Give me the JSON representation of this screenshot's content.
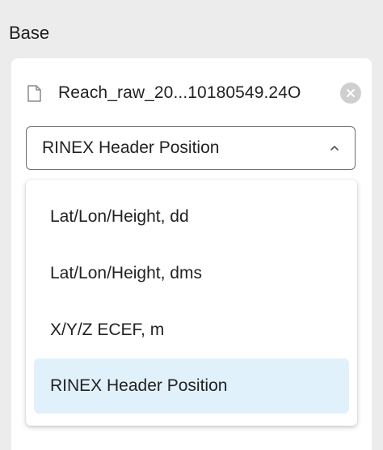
{
  "section": {
    "title": "Base"
  },
  "file": {
    "name": "Reach_raw_20...10180549.24O",
    "icon": "file-icon",
    "clear_icon": "close-circle-icon"
  },
  "select": {
    "value": "RINEX Header Position",
    "icon": "chevron-up-icon"
  },
  "dropdown": {
    "options": [
      {
        "label": "Lat/Lon/Height, dd"
      },
      {
        "label": "Lat/Lon/Height, dms"
      },
      {
        "label": "X/Y/Z ECEF, m"
      },
      {
        "label": "RINEX Header Position",
        "selected": true
      }
    ]
  },
  "colors": {
    "selected_bg": "#e1f1fc",
    "border": "#6f6f6f",
    "background": "#ececec"
  }
}
